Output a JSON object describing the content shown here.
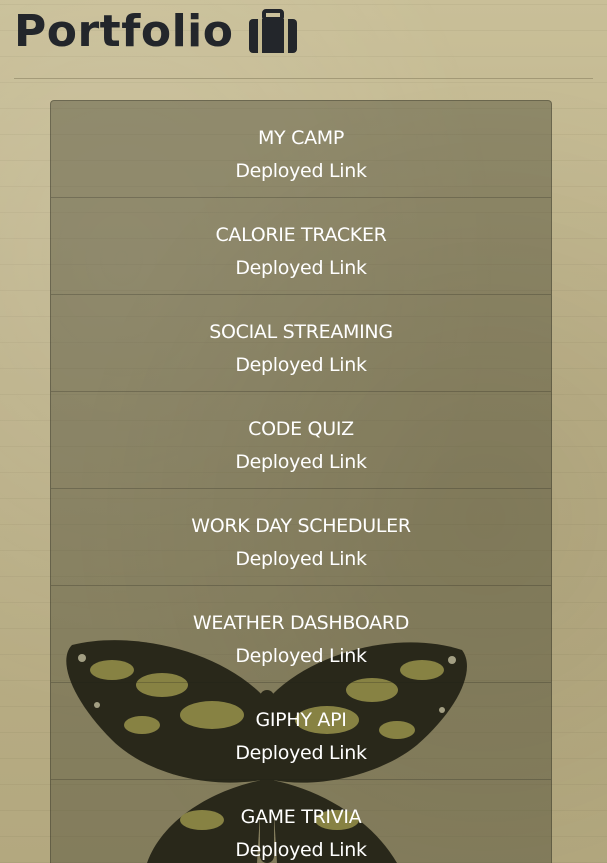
{
  "header": {
    "title": "Portfolio",
    "icon": "briefcase-icon"
  },
  "projects": [
    {
      "name": "MY CAMP",
      "link_label": "Deployed Link"
    },
    {
      "name": "CALORIE TRACKER",
      "link_label": "Deployed Link"
    },
    {
      "name": "SOCIAL STREAMING",
      "link_label": "Deployed Link"
    },
    {
      "name": "CODE QUIZ",
      "link_label": "Deployed Link"
    },
    {
      "name": "WORK DAY SCHEDULER",
      "link_label": "Deployed Link"
    },
    {
      "name": "WEATHER DASHBOARD",
      "link_label": "Deployed Link"
    },
    {
      "name": "GIPHY API",
      "link_label": "Deployed Link"
    },
    {
      "name": "GAME TRIVIA",
      "link_label": "Deployed Link"
    }
  ],
  "colors": {
    "title": "#23262b",
    "background": "#bcb189",
    "panel": "rgba(60,60,40,0.40)",
    "text": "#ffffff"
  }
}
